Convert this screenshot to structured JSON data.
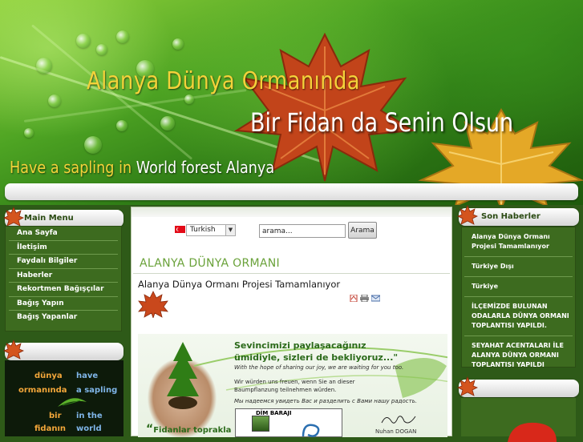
{
  "header": {
    "title_line1": "Alanya Dünya Ormanında",
    "title_line2": "Bir Fidan da Senin Olsun",
    "tagline_part1": "Have a sapling in",
    "tagline_part2": "World forest Alanya"
  },
  "left_menu": {
    "heading": "Main Menu",
    "items": [
      {
        "label": "Ana Sayfa"
      },
      {
        "label": "İletişim"
      },
      {
        "label": "Faydalı Bilgiler"
      },
      {
        "label": "Haberler"
      },
      {
        "label": "Rekortmen Bağışçılar"
      },
      {
        "label": "Bağış Yapın"
      },
      {
        "label": "Bağış Yapanlar"
      }
    ]
  },
  "promo": {
    "words": [
      "dünya",
      "have",
      "ormanında",
      "a sapling",
      "bir",
      "in the",
      "fidanın",
      "world"
    ]
  },
  "toolbar": {
    "language": "Turkish",
    "search_value": "arama...",
    "search_button": "Arama"
  },
  "main": {
    "section_title": "ALANYA DÜNYA ORMANI",
    "article_title": "Alanya Dünya Ormanı Projesi Tamamlanıyor",
    "icons": [
      "pdf-icon",
      "print-icon",
      "email-icon"
    ],
    "banner": {
      "heading_line1": "Sevincimizi paylaşacağınız",
      "heading_line2": "ümidiyle, sizleri de bekliyoruz...\"",
      "en_line": "With the hope of sharing our joy, we are waiting for you too.",
      "de_line1": "Wir würden uns freuen, wenn Sie an dieser",
      "de_line2": "Baumpflanzung  teilnehmen würden.",
      "ru_line": "Мы надеемся увидеть Вас и разделить с Вами нашу радость.",
      "quote": "Fidanlar toprakla",
      "dim_label": "DİM BARAJI",
      "signature_name": "Nuhan DOGAN"
    }
  },
  "right_news": {
    "heading": "Son Haberler",
    "items": [
      {
        "label": "Alanya Dünya Ormanı Projesi Tamamlanıyor"
      },
      {
        "label": "Türkiye Dışı"
      },
      {
        "label": "Türkiye"
      },
      {
        "label": "İLÇEMİZDE BULUNAN ODALARLA DÜNYA ORMANI TOPLANTISI YAPILDI."
      },
      {
        "label": "SEYAHAT ACENTALARI İLE ALANYA DÜNYA ORMANI TOPLANTISI YAPILDI"
      }
    ]
  },
  "colors": {
    "panel_green": "#3d6b1f",
    "title_gold": "#f4d23a",
    "section_green": "#6aa23a"
  }
}
